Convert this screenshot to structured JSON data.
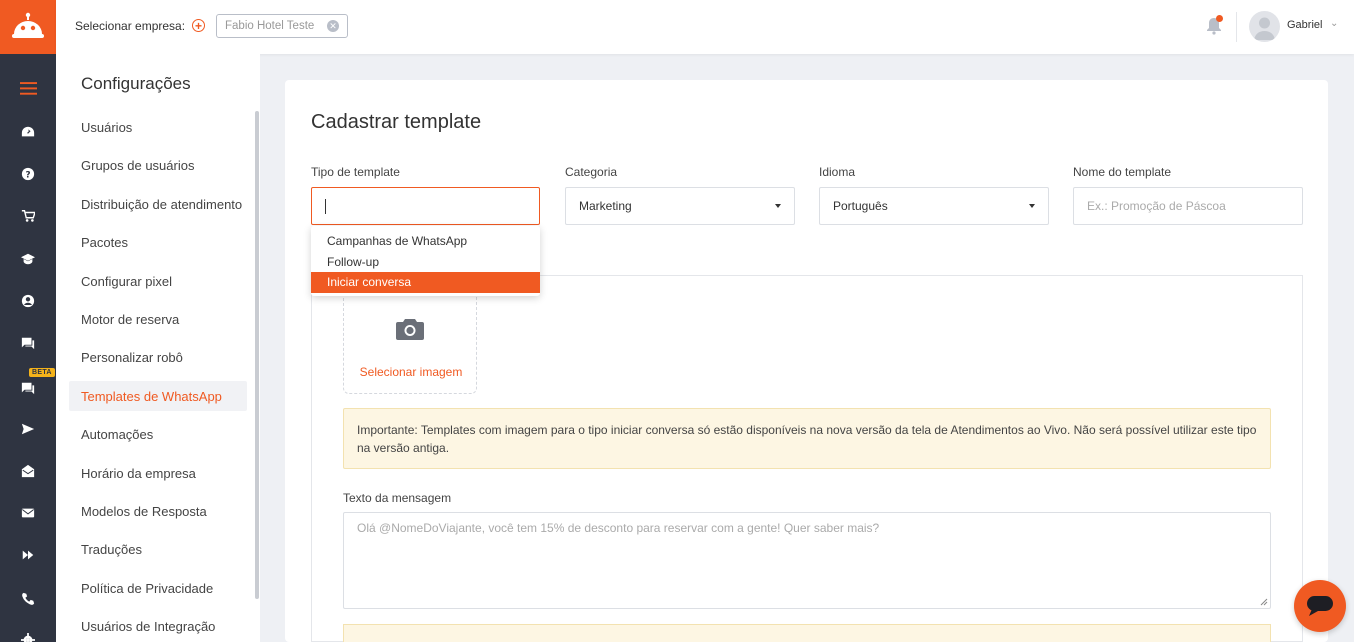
{
  "header": {
    "company_label": "Selecionar empresa:",
    "company_selected": "Fabio Hotel Teste",
    "user_name": "Gabriel"
  },
  "rail": {
    "items": [
      "menu-icon",
      "dashboard-icon",
      "help-icon",
      "cart-icon",
      "graduation-cap-icon",
      "user-icon",
      "chat-icon",
      "chat-beta-icon",
      "send-icon",
      "mail-open-icon",
      "mail-icon",
      "fast-forward-icon",
      "phone-icon",
      "gear-icon"
    ],
    "beta_label": "BETA"
  },
  "settings": {
    "title": "Configurações",
    "items": [
      {
        "label": "Usuários"
      },
      {
        "label": "Grupos de usuários"
      },
      {
        "label": "Distribuição de atendimento"
      },
      {
        "label": "Pacotes"
      },
      {
        "label": "Configurar pixel"
      },
      {
        "label": "Motor de reserva"
      },
      {
        "label": "Personalizar robô"
      },
      {
        "label": "Templates de WhatsApp",
        "active": true
      },
      {
        "label": "Automações"
      },
      {
        "label": "Horário da empresa"
      },
      {
        "label": "Modelos de Resposta"
      },
      {
        "label": "Traduções"
      },
      {
        "label": "Política de Privacidade"
      },
      {
        "label": "Usuários de Integração"
      }
    ]
  },
  "form": {
    "title": "Cadastrar template",
    "tipo_label": "Tipo de template",
    "tipo_value": "",
    "categoria_label": "Categoria",
    "categoria_value": "Marketing",
    "idioma_label": "Idioma",
    "idioma_value": "Português",
    "nome_label": "Nome do template",
    "nome_placeholder": "Ex.: Promoção de Páscoa",
    "select_image": "Selecionar imagem",
    "alert_text": "Importante: Templates com imagem para o tipo iniciar conversa só estão disponíveis na nova versão da tela de Atendimentos ao Vivo. Não será possível utilizar este tipo na versão antiga.",
    "message_label": "Texto da mensagem",
    "message_placeholder": "Olá @NomeDoViajante, você tem 15% de desconto para reservar com a gente! Quer saber mais?"
  },
  "dropdown": {
    "options": [
      "Campanhas de WhatsApp",
      "Follow-up",
      "Iniciar conversa"
    ],
    "highlighted": "Iniciar conversa"
  },
  "colors": {
    "accent": "#f05a22",
    "rail": "#2f3441",
    "alert_bg": "#fdf6e3"
  }
}
